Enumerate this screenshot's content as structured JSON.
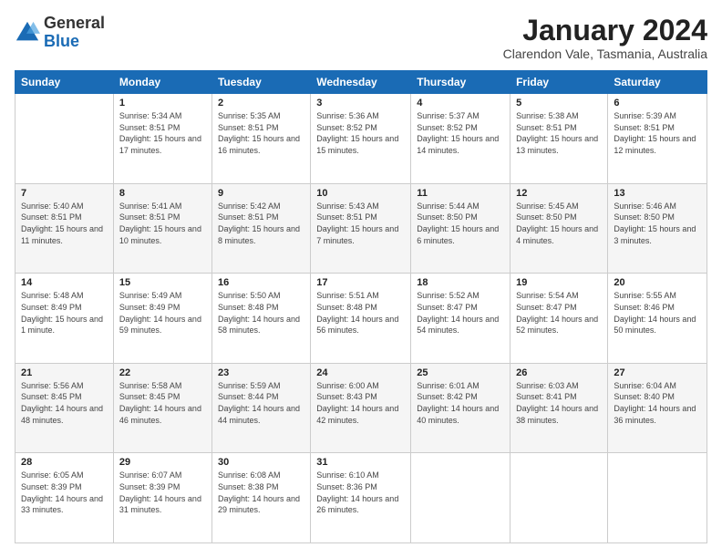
{
  "logo": {
    "general": "General",
    "blue": "Blue"
  },
  "header": {
    "month": "January 2024",
    "location": "Clarendon Vale, Tasmania, Australia"
  },
  "weekdays": [
    "Sunday",
    "Monday",
    "Tuesday",
    "Wednesday",
    "Thursday",
    "Friday",
    "Saturday"
  ],
  "weeks": [
    [
      {
        "day": "",
        "sunrise": "",
        "sunset": "",
        "daylight": ""
      },
      {
        "day": "1",
        "sunrise": "Sunrise: 5:34 AM",
        "sunset": "Sunset: 8:51 PM",
        "daylight": "Daylight: 15 hours and 17 minutes."
      },
      {
        "day": "2",
        "sunrise": "Sunrise: 5:35 AM",
        "sunset": "Sunset: 8:51 PM",
        "daylight": "Daylight: 15 hours and 16 minutes."
      },
      {
        "day": "3",
        "sunrise": "Sunrise: 5:36 AM",
        "sunset": "Sunset: 8:52 PM",
        "daylight": "Daylight: 15 hours and 15 minutes."
      },
      {
        "day": "4",
        "sunrise": "Sunrise: 5:37 AM",
        "sunset": "Sunset: 8:52 PM",
        "daylight": "Daylight: 15 hours and 14 minutes."
      },
      {
        "day": "5",
        "sunrise": "Sunrise: 5:38 AM",
        "sunset": "Sunset: 8:51 PM",
        "daylight": "Daylight: 15 hours and 13 minutes."
      },
      {
        "day": "6",
        "sunrise": "Sunrise: 5:39 AM",
        "sunset": "Sunset: 8:51 PM",
        "daylight": "Daylight: 15 hours and 12 minutes."
      }
    ],
    [
      {
        "day": "7",
        "sunrise": "Sunrise: 5:40 AM",
        "sunset": "Sunset: 8:51 PM",
        "daylight": "Daylight: 15 hours and 11 minutes."
      },
      {
        "day": "8",
        "sunrise": "Sunrise: 5:41 AM",
        "sunset": "Sunset: 8:51 PM",
        "daylight": "Daylight: 15 hours and 10 minutes."
      },
      {
        "day": "9",
        "sunrise": "Sunrise: 5:42 AM",
        "sunset": "Sunset: 8:51 PM",
        "daylight": "Daylight: 15 hours and 8 minutes."
      },
      {
        "day": "10",
        "sunrise": "Sunrise: 5:43 AM",
        "sunset": "Sunset: 8:51 PM",
        "daylight": "Daylight: 15 hours and 7 minutes."
      },
      {
        "day": "11",
        "sunrise": "Sunrise: 5:44 AM",
        "sunset": "Sunset: 8:50 PM",
        "daylight": "Daylight: 15 hours and 6 minutes."
      },
      {
        "day": "12",
        "sunrise": "Sunrise: 5:45 AM",
        "sunset": "Sunset: 8:50 PM",
        "daylight": "Daylight: 15 hours and 4 minutes."
      },
      {
        "day": "13",
        "sunrise": "Sunrise: 5:46 AM",
        "sunset": "Sunset: 8:50 PM",
        "daylight": "Daylight: 15 hours and 3 minutes."
      }
    ],
    [
      {
        "day": "14",
        "sunrise": "Sunrise: 5:48 AM",
        "sunset": "Sunset: 8:49 PM",
        "daylight": "Daylight: 15 hours and 1 minute."
      },
      {
        "day": "15",
        "sunrise": "Sunrise: 5:49 AM",
        "sunset": "Sunset: 8:49 PM",
        "daylight": "Daylight: 14 hours and 59 minutes."
      },
      {
        "day": "16",
        "sunrise": "Sunrise: 5:50 AM",
        "sunset": "Sunset: 8:48 PM",
        "daylight": "Daylight: 14 hours and 58 minutes."
      },
      {
        "day": "17",
        "sunrise": "Sunrise: 5:51 AM",
        "sunset": "Sunset: 8:48 PM",
        "daylight": "Daylight: 14 hours and 56 minutes."
      },
      {
        "day": "18",
        "sunrise": "Sunrise: 5:52 AM",
        "sunset": "Sunset: 8:47 PM",
        "daylight": "Daylight: 14 hours and 54 minutes."
      },
      {
        "day": "19",
        "sunrise": "Sunrise: 5:54 AM",
        "sunset": "Sunset: 8:47 PM",
        "daylight": "Daylight: 14 hours and 52 minutes."
      },
      {
        "day": "20",
        "sunrise": "Sunrise: 5:55 AM",
        "sunset": "Sunset: 8:46 PM",
        "daylight": "Daylight: 14 hours and 50 minutes."
      }
    ],
    [
      {
        "day": "21",
        "sunrise": "Sunrise: 5:56 AM",
        "sunset": "Sunset: 8:45 PM",
        "daylight": "Daylight: 14 hours and 48 minutes."
      },
      {
        "day": "22",
        "sunrise": "Sunrise: 5:58 AM",
        "sunset": "Sunset: 8:45 PM",
        "daylight": "Daylight: 14 hours and 46 minutes."
      },
      {
        "day": "23",
        "sunrise": "Sunrise: 5:59 AM",
        "sunset": "Sunset: 8:44 PM",
        "daylight": "Daylight: 14 hours and 44 minutes."
      },
      {
        "day": "24",
        "sunrise": "Sunrise: 6:00 AM",
        "sunset": "Sunset: 8:43 PM",
        "daylight": "Daylight: 14 hours and 42 minutes."
      },
      {
        "day": "25",
        "sunrise": "Sunrise: 6:01 AM",
        "sunset": "Sunset: 8:42 PM",
        "daylight": "Daylight: 14 hours and 40 minutes."
      },
      {
        "day": "26",
        "sunrise": "Sunrise: 6:03 AM",
        "sunset": "Sunset: 8:41 PM",
        "daylight": "Daylight: 14 hours and 38 minutes."
      },
      {
        "day": "27",
        "sunrise": "Sunrise: 6:04 AM",
        "sunset": "Sunset: 8:40 PM",
        "daylight": "Daylight: 14 hours and 36 minutes."
      }
    ],
    [
      {
        "day": "28",
        "sunrise": "Sunrise: 6:05 AM",
        "sunset": "Sunset: 8:39 PM",
        "daylight": "Daylight: 14 hours and 33 minutes."
      },
      {
        "day": "29",
        "sunrise": "Sunrise: 6:07 AM",
        "sunset": "Sunset: 8:39 PM",
        "daylight": "Daylight: 14 hours and 31 minutes."
      },
      {
        "day": "30",
        "sunrise": "Sunrise: 6:08 AM",
        "sunset": "Sunset: 8:38 PM",
        "daylight": "Daylight: 14 hours and 29 minutes."
      },
      {
        "day": "31",
        "sunrise": "Sunrise: 6:10 AM",
        "sunset": "Sunset: 8:36 PM",
        "daylight": "Daylight: 14 hours and 26 minutes."
      },
      {
        "day": "",
        "sunrise": "",
        "sunset": "",
        "daylight": ""
      },
      {
        "day": "",
        "sunrise": "",
        "sunset": "",
        "daylight": ""
      },
      {
        "day": "",
        "sunrise": "",
        "sunset": "",
        "daylight": ""
      }
    ]
  ]
}
